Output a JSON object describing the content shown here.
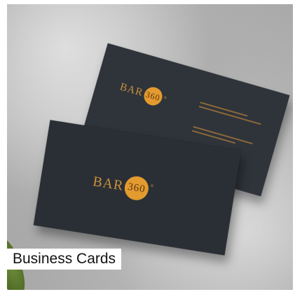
{
  "tile": {
    "caption": "Business Cards"
  },
  "cards": {
    "logo_word": "BAR",
    "logo_number": "360",
    "logo_mark": "®"
  },
  "colors": {
    "card": "#2b3036",
    "accent": "#e39a2f",
    "background": "#bdbdbd"
  }
}
